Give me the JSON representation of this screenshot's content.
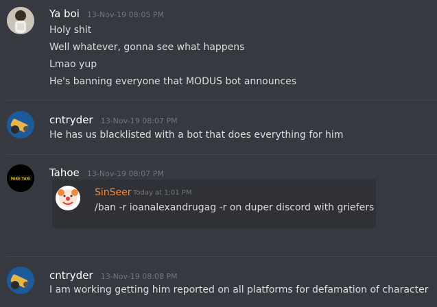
{
  "messages": [
    {
      "author": "Ya boi",
      "timestamp": "13-Nov-19 08:05 PM",
      "avatar_icon": "person-photo",
      "lines": [
        "Holy shit",
        "Well whatever, gonna see what happens",
        "Lmao yup",
        "He's banning everyone that MODUS bot announces"
      ]
    },
    {
      "author": "cntryder",
      "timestamp": "13-Nov-19 08:07 PM",
      "avatar_icon": "cannon-icon",
      "lines": [
        "He has us blacklisted with a bot that does everything for him"
      ]
    },
    {
      "author": "Tahoe",
      "timestamp": "13-Nov-19 08:07 PM",
      "avatar_icon": "fake-taxi-logo",
      "avatar_text": "FAKE TAXI",
      "quote": {
        "author": "SinSeer",
        "timestamp": "Today at 1:01 PM",
        "avatar_icon": "clown-icon",
        "text": "/ban -r ioanalexandrugag -r on duper discord with griefers"
      }
    },
    {
      "author": "cntryder",
      "timestamp": "13-Nov-19 08:08 PM",
      "avatar_icon": "cannon-icon",
      "lines": [
        "I am working getting him reported on all platforms for defamation of character"
      ]
    }
  ],
  "colors": {
    "background": "#36393f",
    "username": "#ffffff",
    "timestamp": "#72767d",
    "text": "#dcddde",
    "quote_author": "#f0883d",
    "quote_bg": "#2f3136"
  }
}
